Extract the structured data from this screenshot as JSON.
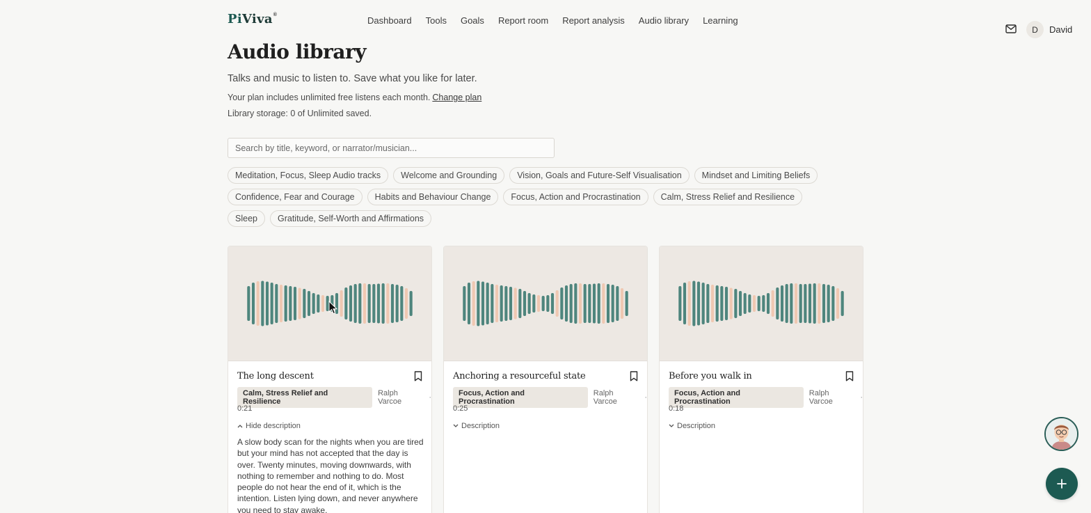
{
  "brand": {
    "name_pi": "Pi",
    "name_rest": "Viva",
    "mark": "®"
  },
  "nav": [
    "Dashboard",
    "Tools",
    "Goals",
    "Report room",
    "Report analysis",
    "Audio library",
    "Learning"
  ],
  "user": {
    "initial": "D",
    "name": "David"
  },
  "page": {
    "title": "Audio library",
    "subtitle": "Talks and music to listen to. Save what you like for later.",
    "plan_text": "Your plan includes unlimited free listens each month.",
    "change_plan": "Change plan",
    "storage": "Library storage: 0 of Unlimited saved."
  },
  "search": {
    "placeholder": "Search by title, keyword, or narrator/musician..."
  },
  "tags": [
    "Meditation, Focus, Sleep Audio tracks",
    "Welcome and Grounding",
    "Vision, Goals and Future-Self Visualisation",
    "Mindset and Limiting Beliefs",
    "Confidence, Fear and Courage",
    "Habits and Behaviour Change",
    "Focus, Action and Procrastination",
    "Calm, Stress Relief and Resilience",
    "Sleep",
    "Gratitude, Self-Worth and Affirmations"
  ],
  "cards": [
    {
      "title": "The long descent",
      "category": "Calm, Stress Relief and Resilience",
      "author": "Ralph Varcoe",
      "separator": "·",
      "duration": "0:21",
      "toggle": "Hide description",
      "expanded": true,
      "description": "A slow body scan for the nights when you are tired but your mind has not accepted that the day is over. Twenty minutes, moving downwards, with nothing to remember and nothing to do. Most people do not hear the end of it, which is the intention. Listen lying down, and never anywhere you need to stay awake."
    },
    {
      "title": "Anchoring a resourceful state",
      "category": "Focus, Action and Procrastination",
      "author": "Ralph Varcoe",
      "separator": "·",
      "duration": "0:25",
      "toggle": "Description",
      "expanded": false,
      "description": ""
    },
    {
      "title": "Before you walk in",
      "category": "Focus, Action and Procrastination",
      "author": "Ralph Varcoe",
      "separator": "·",
      "duration": "0:18",
      "toggle": "Description",
      "expanded": false,
      "description": ""
    }
  ],
  "colors": {
    "accent": "#1d5a52",
    "wave_dark": "#4e857d",
    "wave_light": "#efc8b2",
    "thumb_bg": "#ede8e3"
  },
  "icons": {
    "mail": "envelope-icon",
    "bookmark": "bookmark-icon",
    "fab": "plus-icon",
    "chevron_up": "chevron-up-icon",
    "chevron_down": "chevron-down-icon"
  }
}
